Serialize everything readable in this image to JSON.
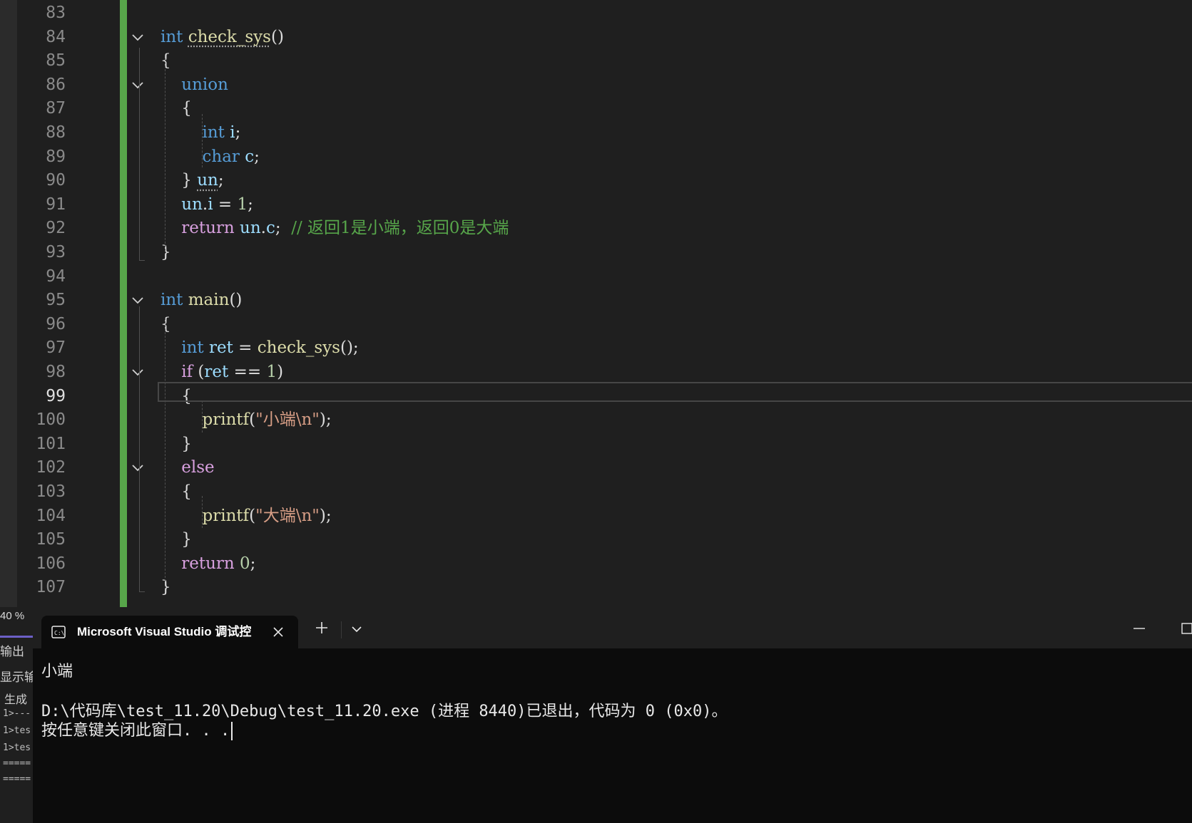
{
  "editor": {
    "lines": [
      {
        "num": "83",
        "tokens": []
      },
      {
        "num": "84",
        "tokens": [
          {
            "c": "kw",
            "t": "int "
          },
          {
            "c": "fn squiggle",
            "t": "check_sys"
          },
          {
            "c": "pl",
            "t": "()"
          }
        ]
      },
      {
        "num": "85",
        "tokens": [
          {
            "c": "pl",
            "t": "{"
          }
        ]
      },
      {
        "num": "86",
        "tokens": [
          {
            "c": "pl",
            "t": "    "
          },
          {
            "c": "kw",
            "t": "union"
          }
        ]
      },
      {
        "num": "87",
        "tokens": [
          {
            "c": "pl",
            "t": "    {"
          }
        ]
      },
      {
        "num": "88",
        "tokens": [
          {
            "c": "pl",
            "t": "        "
          },
          {
            "c": "kw",
            "t": "int "
          },
          {
            "c": "var",
            "t": "i"
          },
          {
            "c": "pl",
            "t": ";"
          }
        ]
      },
      {
        "num": "89",
        "tokens": [
          {
            "c": "pl",
            "t": "        "
          },
          {
            "c": "kw",
            "t": "char "
          },
          {
            "c": "var",
            "t": "c"
          },
          {
            "c": "pl",
            "t": ";"
          }
        ]
      },
      {
        "num": "90",
        "tokens": [
          {
            "c": "pl",
            "t": "    } "
          },
          {
            "c": "var squiggle",
            "t": "un"
          },
          {
            "c": "pl",
            "t": ";"
          }
        ]
      },
      {
        "num": "91",
        "tokens": [
          {
            "c": "pl",
            "t": "    "
          },
          {
            "c": "var",
            "t": "un"
          },
          {
            "c": "pl",
            "t": "."
          },
          {
            "c": "var",
            "t": "i"
          },
          {
            "c": "pl",
            "t": " = "
          },
          {
            "c": "num",
            "t": "1"
          },
          {
            "c": "pl",
            "t": ";"
          }
        ]
      },
      {
        "num": "92",
        "tokens": [
          {
            "c": "pl",
            "t": "    "
          },
          {
            "c": "ctl",
            "t": "return "
          },
          {
            "c": "var",
            "t": "un"
          },
          {
            "c": "pl",
            "t": "."
          },
          {
            "c": "var",
            "t": "c"
          },
          {
            "c": "pl",
            "t": ";  "
          },
          {
            "c": "cmt",
            "t": "// 返回1是小端，返回0是大端"
          }
        ]
      },
      {
        "num": "93",
        "tokens": [
          {
            "c": "pl",
            "t": "}"
          }
        ]
      },
      {
        "num": "94",
        "tokens": []
      },
      {
        "num": "95",
        "tokens": [
          {
            "c": "kw",
            "t": "int "
          },
          {
            "c": "fn",
            "t": "main"
          },
          {
            "c": "pl",
            "t": "()"
          }
        ]
      },
      {
        "num": "96",
        "tokens": [
          {
            "c": "pl",
            "t": "{"
          }
        ]
      },
      {
        "num": "97",
        "tokens": [
          {
            "c": "pl",
            "t": "    "
          },
          {
            "c": "kw",
            "t": "int "
          },
          {
            "c": "var",
            "t": "ret"
          },
          {
            "c": "pl",
            "t": " = "
          },
          {
            "c": "fn",
            "t": "check_sys"
          },
          {
            "c": "pl",
            "t": "();"
          }
        ]
      },
      {
        "num": "98",
        "tokens": [
          {
            "c": "pl",
            "t": "    "
          },
          {
            "c": "ctl",
            "t": "if"
          },
          {
            "c": "pl",
            "t": " ("
          },
          {
            "c": "var",
            "t": "ret"
          },
          {
            "c": "pl",
            "t": " == "
          },
          {
            "c": "num",
            "t": "1"
          },
          {
            "c": "pl",
            "t": ")"
          }
        ]
      },
      {
        "num": "99",
        "tokens": [
          {
            "c": "pl",
            "t": "    {"
          }
        ]
      },
      {
        "num": "100",
        "tokens": [
          {
            "c": "pl",
            "t": "        "
          },
          {
            "c": "fn",
            "t": "printf"
          },
          {
            "c": "pl",
            "t": "("
          },
          {
            "c": "str",
            "t": "\"小端\\n\""
          },
          {
            "c": "pl",
            "t": ");"
          }
        ]
      },
      {
        "num": "101",
        "tokens": [
          {
            "c": "pl",
            "t": "    }"
          }
        ]
      },
      {
        "num": "102",
        "tokens": [
          {
            "c": "pl",
            "t": "    "
          },
          {
            "c": "ctl",
            "t": "else"
          }
        ]
      },
      {
        "num": "103",
        "tokens": [
          {
            "c": "pl",
            "t": "    {"
          }
        ]
      },
      {
        "num": "104",
        "tokens": [
          {
            "c": "pl",
            "t": "        "
          },
          {
            "c": "fn",
            "t": "printf"
          },
          {
            "c": "pl",
            "t": "("
          },
          {
            "c": "str",
            "t": "\"大端\\n\""
          },
          {
            "c": "pl",
            "t": ");"
          }
        ]
      },
      {
        "num": "105",
        "tokens": [
          {
            "c": "pl",
            "t": "    }"
          }
        ]
      },
      {
        "num": "106",
        "tokens": [
          {
            "c": "pl",
            "t": "    "
          },
          {
            "c": "ctl",
            "t": "return "
          },
          {
            "c": "num",
            "t": "0"
          },
          {
            "c": "pl",
            "t": ";"
          }
        ]
      },
      {
        "num": "107",
        "tokens": [
          {
            "c": "pl",
            "t": "}"
          }
        ]
      }
    ],
    "current_line": "99",
    "fold_lines": [
      "84",
      "86",
      "95",
      "98",
      "102"
    ]
  },
  "left_pane": {
    "zoom": "40 %",
    "output_label": "输出",
    "show_output_label": "显示输",
    "build_label": "生成",
    "log_lines": [
      "1>---",
      "1>tes",
      "1>tes",
      "=====",
      "====="
    ]
  },
  "terminal": {
    "tab_title": "Microsoft Visual Studio 调试控",
    "output_line1": "小端",
    "output_line2": "D:\\代码库\\test_11.20\\Debug\\test_11.20.exe (进程 8440)已退出，代码为 0 (0x0)。",
    "output_line3": "按任意键关闭此窗口. . ."
  },
  "colors": {
    "keyword": "#569cd6",
    "function": "#dcdcaa",
    "variable": "#9cdcfe",
    "number": "#b5cea8",
    "string": "#d69d85",
    "comment": "#57a64a",
    "control": "#d8a0df",
    "change_bar": "#57a64a"
  }
}
